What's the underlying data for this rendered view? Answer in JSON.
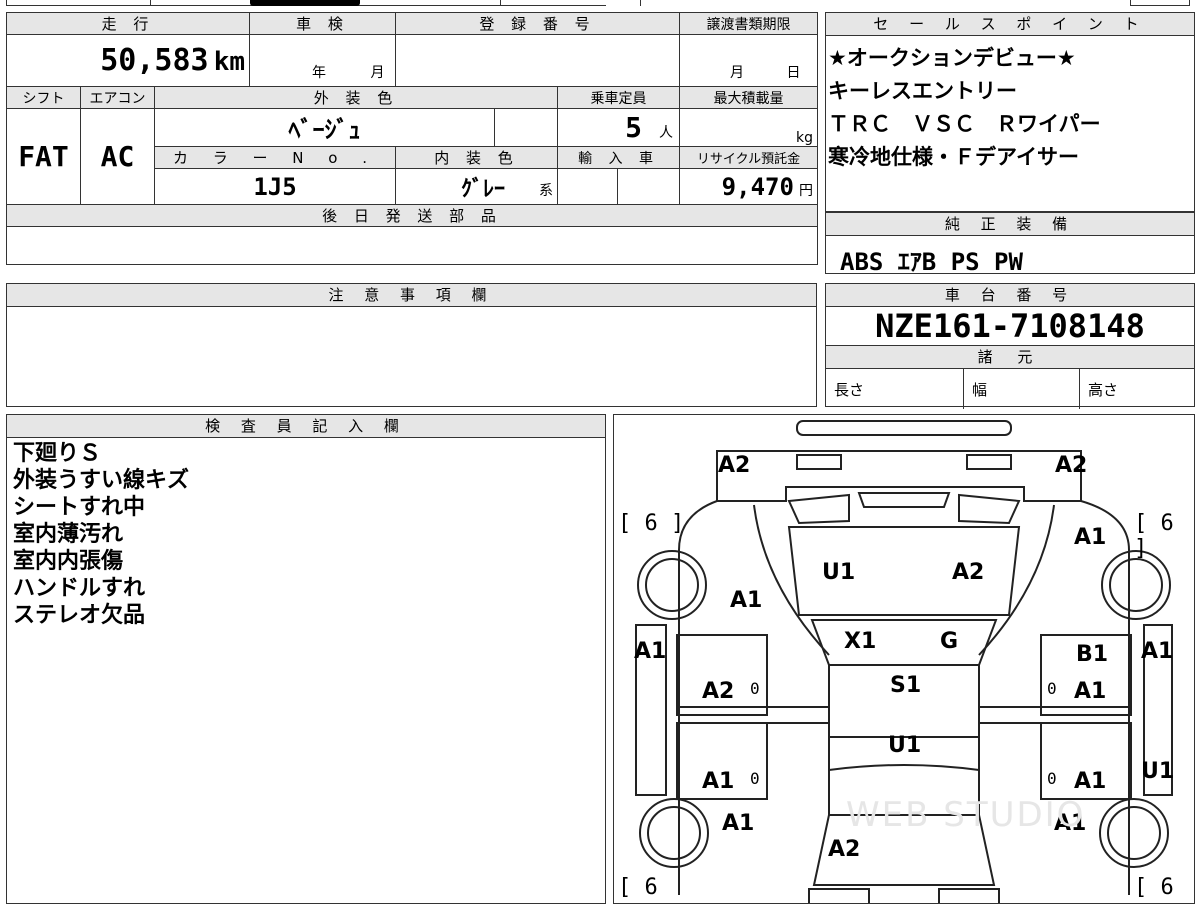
{
  "top": {
    "mileage_header": "走 行",
    "mileage": "50,583",
    "mileage_unit": "km",
    "inspection_header": "車 検",
    "inspection_year": "年",
    "inspection_month": "月",
    "registration_header": "登 録 番 号",
    "transfer_header": "譲渡書類期限",
    "transfer_month": "月",
    "transfer_day": "日",
    "shift_header": "シフト",
    "shift": "FAT",
    "ac_header": "エアコン",
    "ac": "AC",
    "exterior_header": "外 装 色",
    "exterior": "ﾍﾞｰｼﾞｭ",
    "capacity_header": "乗車定員",
    "capacity": "5",
    "capacity_unit": "人",
    "load_header": "最大積載量",
    "load_unit": "kg",
    "color_no_header": "カ ラ ー N o .",
    "color_no": "1J5",
    "interior_header": "内 装 色",
    "interior": "ｸﾞﾚｰ",
    "interior_suffix": "系",
    "import_header": "輸 入 車",
    "recycle_header": "リサイクル預託金",
    "recycle": "9,470",
    "recycle_unit": "円",
    "later_parts_header": "後 日 発 送 部 品"
  },
  "sales": {
    "header": "セ ー ル ス ポ イ ン ト",
    "lines": [
      "★オークションデビュー★",
      "キーレスエントリー",
      "ＴＲＣ　ＶＳＣ　Ｒワイパー",
      "寒冷地仕様・Ｆデアイサー"
    ]
  },
  "equipment": {
    "header": "純 正 装 備",
    "value": "ABS ｴｱB PS PW"
  },
  "notes": {
    "header": "注 意 事 項 欄"
  },
  "chassis": {
    "header": "車 台 番 号",
    "value": "NZE161-7108148",
    "specs_header": "諸 元",
    "length": "長さ",
    "width": "幅",
    "height": "高さ"
  },
  "inspector": {
    "header": "検 査 員 記 入 欄",
    "lines": [
      "下廻りＳ",
      "外装うすい線キズ",
      "シートすれ中",
      "室内薄汚れ",
      "室内内張傷",
      "ハンドルすれ",
      "ステレオ欠品"
    ]
  },
  "diagram": {
    "tires": [
      "[ 6 ]",
      "[ 6 ]",
      "[ 6",
      "[ 6"
    ],
    "marks": [
      "A2",
      "A2",
      "A1",
      "U1",
      "A2",
      "A1",
      "X1",
      "G",
      "A1",
      "A1",
      "B1",
      "S1",
      "A2",
      "A1",
      "U1",
      "A1",
      "A1",
      "U1",
      "A1",
      "A1",
      "A2"
    ],
    "zero": "0",
    "watermark": "WEB STUDIO"
  }
}
